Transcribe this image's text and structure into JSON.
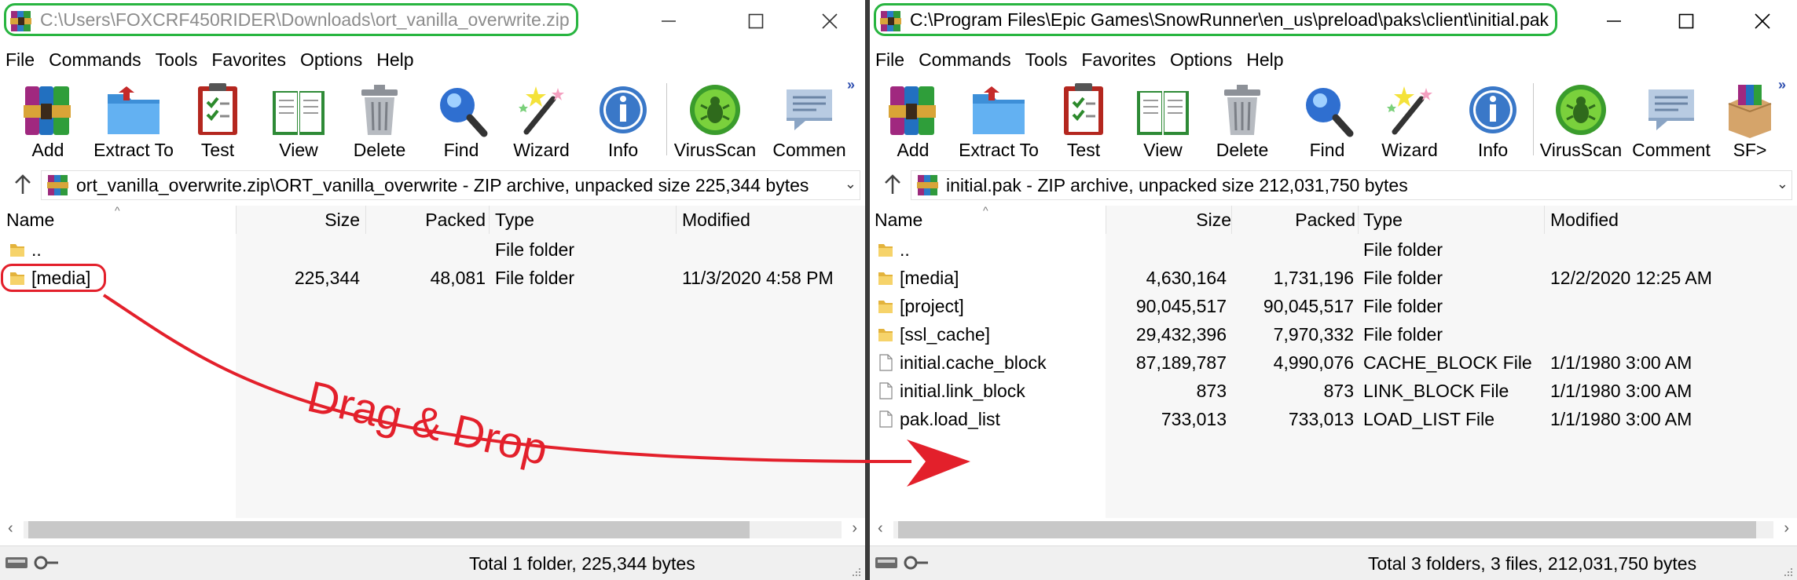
{
  "left": {
    "title": "C:\\Users\\FOXCRF450RIDER\\Downloads\\ort_vanilla_overwrite.zip",
    "menu": [
      "File",
      "Commands",
      "Tools",
      "Favorites",
      "Options",
      "Help"
    ],
    "toolbar": [
      "Add",
      "Extract To",
      "Test",
      "View",
      "Delete",
      "Find",
      "Wizard",
      "Info",
      "VirusScan",
      "Commen"
    ],
    "address": "ort_vanilla_overwrite.zip\\ORT_vanilla_overwrite - ZIP archive, unpacked size 225,344 bytes",
    "columns": {
      "name": "Name",
      "size": "Size",
      "packed": "Packed",
      "type": "Type",
      "modified": "Modified"
    },
    "rows": [
      {
        "name": "..",
        "size": "",
        "packed": "",
        "type": "File folder",
        "modified": ""
      },
      {
        "name": "[media]",
        "size": "225,344",
        "packed": "48,081",
        "type": "File folder",
        "modified": "11/3/2020 4:58 PM"
      }
    ],
    "status": "Total 1 folder, 225,344 bytes"
  },
  "right": {
    "title": "C:\\Program Files\\Epic Games\\SnowRunner\\en_us\\preload\\paks\\client\\initial.pak",
    "menu": [
      "File",
      "Commands",
      "Tools",
      "Favorites",
      "Options",
      "Help"
    ],
    "toolbar": [
      "Add",
      "Extract To",
      "Test",
      "View",
      "Delete",
      "Find",
      "Wizard",
      "Info",
      "VirusScan",
      "Comment",
      "SF>"
    ],
    "address": "initial.pak - ZIP archive, unpacked size 212,031,750 bytes",
    "columns": {
      "name": "Name",
      "size": "Size",
      "packed": "Packed",
      "type": "Type",
      "modified": "Modified"
    },
    "rows": [
      {
        "name": "..",
        "size": "",
        "packed": "",
        "type": "File folder",
        "modified": ""
      },
      {
        "name": "[media]",
        "size": "4,630,164",
        "packed": "1,731,196",
        "type": "File folder",
        "modified": "12/2/2020 12:25 AM"
      },
      {
        "name": "[project]",
        "size": "90,045,517",
        "packed": "90,045,517",
        "type": "File folder",
        "modified": ""
      },
      {
        "name": "[ssl_cache]",
        "size": "29,432,396",
        "packed": "7,970,332",
        "type": "File folder",
        "modified": ""
      },
      {
        "name": "initial.cache_block",
        "size": "87,189,787",
        "packed": "4,990,076",
        "type": "CACHE_BLOCK File",
        "modified": "1/1/1980 3:00 AM"
      },
      {
        "name": "initial.link_block",
        "size": "873",
        "packed": "873",
        "type": "LINK_BLOCK File",
        "modified": "1/1/1980 3:00 AM"
      },
      {
        "name": "pak.load_list",
        "size": "733,013",
        "packed": "733,013",
        "type": "LOAD_LIST File",
        "modified": "1/1/1980 3:00 AM"
      }
    ],
    "status": "Total 3 folders, 3 files, 212,031,750 bytes"
  },
  "annotation": {
    "text": "Drag & Drop",
    "color": "#e3202b",
    "highlight_color": "#28b540"
  }
}
